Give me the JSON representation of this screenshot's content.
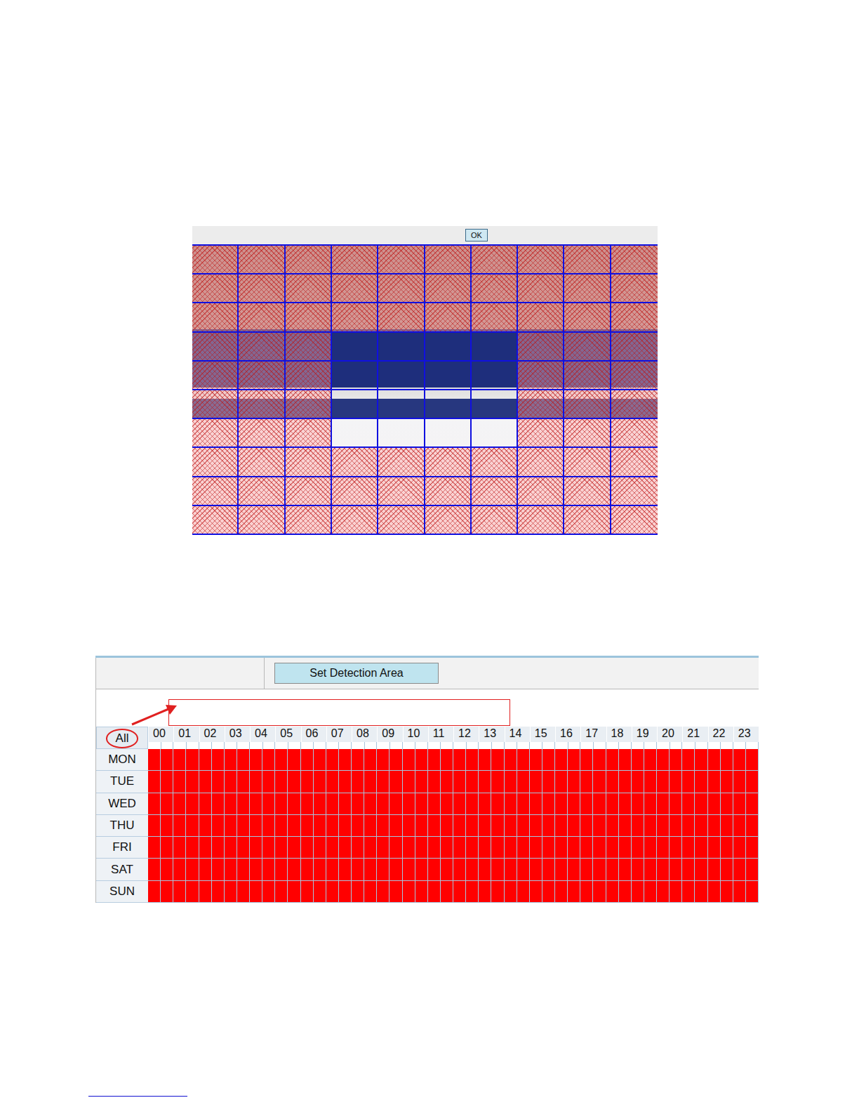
{
  "detection_area": {
    "ok_button": "OK",
    "rows": [
      [
        true,
        true,
        true,
        true,
        true,
        true,
        true,
        true,
        true,
        true
      ],
      [
        true,
        true,
        true,
        true,
        true,
        true,
        true,
        true,
        true,
        true
      ],
      [
        true,
        true,
        true,
        true,
        true,
        true,
        true,
        true,
        true,
        true
      ],
      [
        true,
        true,
        true,
        false,
        false,
        false,
        false,
        true,
        true,
        true
      ],
      [
        true,
        true,
        true,
        false,
        false,
        false,
        false,
        true,
        true,
        true
      ],
      [
        true,
        true,
        true,
        false,
        false,
        false,
        false,
        true,
        true,
        true
      ],
      [
        true,
        true,
        true,
        false,
        false,
        false,
        false,
        true,
        true,
        true
      ],
      [
        true,
        true,
        true,
        true,
        true,
        true,
        true,
        true,
        true,
        true
      ],
      [
        true,
        true,
        true,
        true,
        true,
        true,
        true,
        true,
        true,
        true
      ],
      [
        true,
        true,
        true,
        true,
        true,
        true,
        true,
        true,
        true,
        true
      ]
    ]
  },
  "schedule": {
    "set_area_button": "Set Detection Area",
    "all_label": "All",
    "hours": [
      "00",
      "01",
      "02",
      "03",
      "04",
      "05",
      "06",
      "07",
      "08",
      "09",
      "10",
      "11",
      "12",
      "13",
      "14",
      "15",
      "16",
      "17",
      "18",
      "19",
      "20",
      "21",
      "22",
      "23"
    ],
    "days": [
      {
        "label": "MON",
        "slots": [
          true,
          true,
          true,
          true,
          true,
          true,
          true,
          true,
          true,
          true,
          true,
          true,
          true,
          true,
          true,
          true,
          true,
          true,
          true,
          true,
          true,
          true,
          true,
          true,
          true,
          true,
          true,
          true,
          true,
          true,
          true,
          true,
          true,
          true,
          true,
          true,
          true,
          true,
          true,
          true,
          true,
          true,
          true,
          true,
          true,
          true,
          true,
          true
        ]
      },
      {
        "label": "TUE",
        "slots": [
          true,
          true,
          true,
          true,
          true,
          true,
          true,
          true,
          true,
          true,
          true,
          true,
          true,
          true,
          true,
          true,
          true,
          true,
          true,
          true,
          true,
          true,
          true,
          true,
          true,
          true,
          true,
          true,
          true,
          true,
          true,
          true,
          true,
          true,
          true,
          true,
          true,
          true,
          true,
          true,
          true,
          true,
          true,
          true,
          true,
          true,
          true,
          true
        ]
      },
      {
        "label": "WED",
        "slots": [
          true,
          true,
          true,
          true,
          true,
          true,
          true,
          true,
          true,
          true,
          true,
          true,
          true,
          true,
          true,
          true,
          true,
          true,
          true,
          true,
          true,
          true,
          true,
          true,
          true,
          true,
          true,
          true,
          true,
          true,
          true,
          true,
          true,
          true,
          true,
          true,
          true,
          true,
          true,
          true,
          true,
          true,
          true,
          true,
          true,
          true,
          true,
          true
        ]
      },
      {
        "label": "THU",
        "slots": [
          true,
          true,
          true,
          true,
          true,
          true,
          true,
          true,
          true,
          true,
          true,
          true,
          true,
          true,
          true,
          true,
          true,
          true,
          true,
          true,
          true,
          true,
          true,
          true,
          true,
          true,
          true,
          true,
          true,
          true,
          true,
          true,
          true,
          true,
          true,
          true,
          true,
          true,
          true,
          true,
          true,
          true,
          true,
          true,
          true,
          true,
          true,
          true
        ]
      },
      {
        "label": "FRI",
        "slots": [
          true,
          true,
          true,
          true,
          true,
          true,
          true,
          true,
          true,
          true,
          true,
          true,
          true,
          true,
          true,
          true,
          true,
          true,
          true,
          true,
          true,
          true,
          true,
          true,
          true,
          true,
          true,
          true,
          true,
          true,
          true,
          true,
          true,
          true,
          true,
          true,
          true,
          true,
          true,
          true,
          true,
          true,
          true,
          true,
          true,
          true,
          true,
          true
        ]
      },
      {
        "label": "SAT",
        "slots": [
          true,
          true,
          true,
          true,
          true,
          true,
          true,
          true,
          true,
          true,
          true,
          true,
          true,
          true,
          true,
          true,
          true,
          true,
          true,
          true,
          true,
          true,
          true,
          true,
          true,
          true,
          true,
          true,
          true,
          true,
          true,
          true,
          true,
          true,
          true,
          true,
          true,
          true,
          true,
          true,
          true,
          true,
          true,
          true,
          true,
          true,
          true,
          true
        ]
      },
      {
        "label": "SUN",
        "slots": [
          true,
          true,
          true,
          true,
          true,
          true,
          true,
          true,
          true,
          true,
          true,
          true,
          true,
          true,
          true,
          true,
          true,
          true,
          true,
          true,
          true,
          true,
          true,
          true,
          true,
          true,
          true,
          true,
          true,
          true,
          true,
          true,
          true,
          true,
          true,
          true,
          true,
          true,
          true,
          true,
          true,
          true,
          true,
          true,
          true,
          true,
          true,
          true
        ]
      }
    ]
  }
}
